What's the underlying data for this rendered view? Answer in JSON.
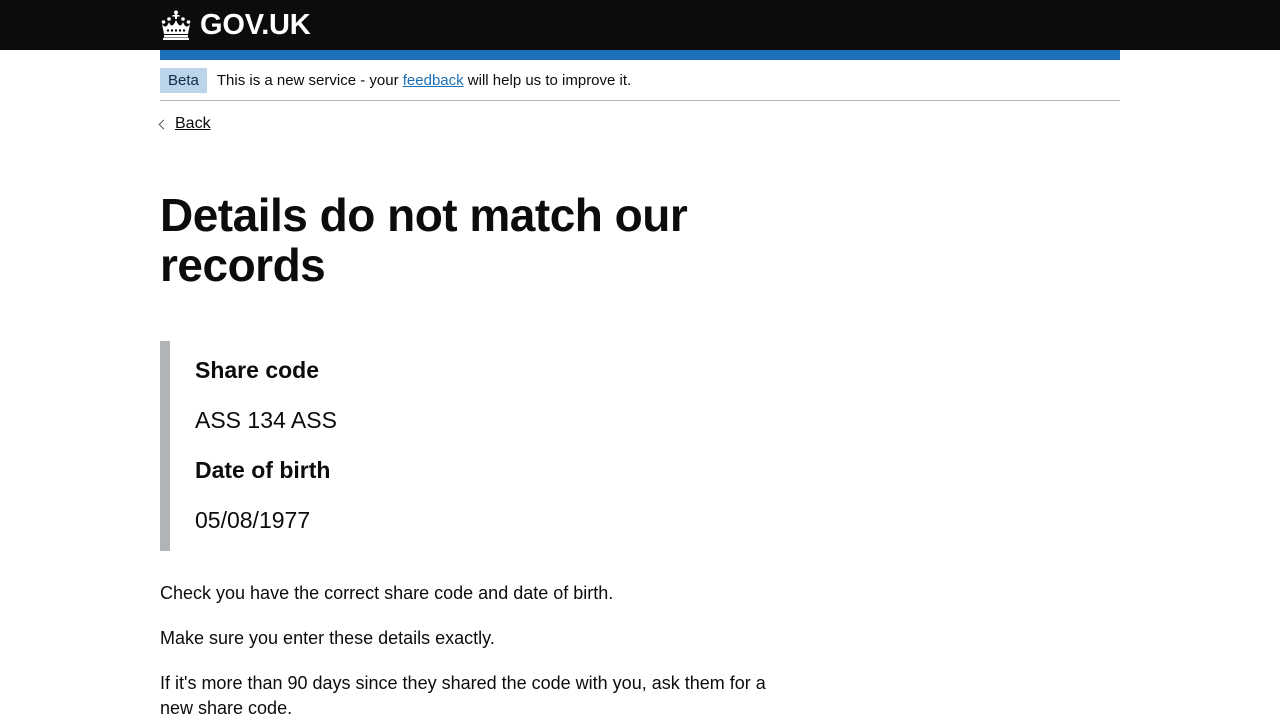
{
  "header": {
    "logo_text": "GOV.UK",
    "logo_icon": "crown-icon"
  },
  "phase_banner": {
    "tag": "Beta",
    "text_before": "This is a new service - your ",
    "link_text": "feedback",
    "text_after": " will help us to improve it."
  },
  "nav": {
    "back_label": "Back"
  },
  "main": {
    "title": "Details do not match our records",
    "details": {
      "share_code_label": "Share code",
      "share_code_value": "ASS 134 ASS",
      "dob_label": "Date of birth",
      "dob_value": "05/08/1977"
    },
    "paragraphs": [
      "Check you have the correct share code and date of birth.",
      "Make sure you enter these details exactly.",
      "If it's more than 90 days since they shared the code with you, ask them for a new share code."
    ]
  },
  "colors": {
    "header_bg": "#0b0c0c",
    "brand_blue": "#1d70b8",
    "tag_bg": "#bbd4ea",
    "inset_border": "#b1b4b6"
  }
}
